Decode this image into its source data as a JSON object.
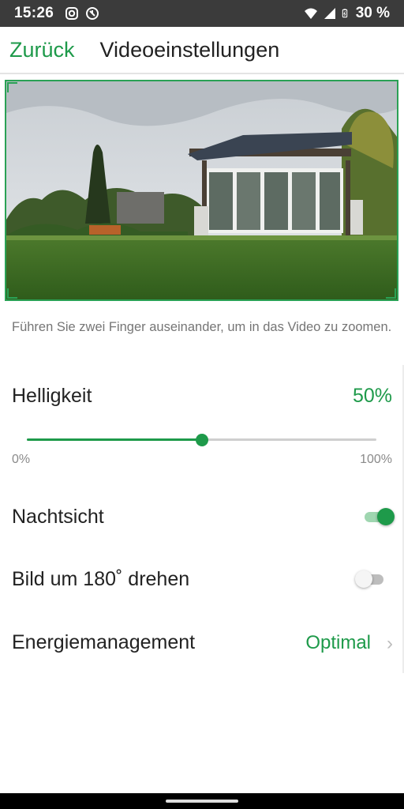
{
  "status_bar": {
    "time": "15:26",
    "left_icons": [
      "instagram-icon",
      "app-notification-icon"
    ],
    "right_icons": [
      "wifi-icon",
      "signal-icon",
      "battery-icon"
    ],
    "battery": "30 %"
  },
  "header": {
    "back_label": "Zurück",
    "title": "Videoeinstellungen"
  },
  "video_preview": {
    "description_icon": "camera-live-view"
  },
  "hint": "Führen Sie zwei Finger auseinander, um in das Video zu zoomen.",
  "brightness": {
    "label": "Helligkeit",
    "value_text": "50%",
    "value": 0.5,
    "min_label": "0%",
    "max_label": "100%"
  },
  "night_vision": {
    "label": "Nachtsicht",
    "enabled": true
  },
  "rotate": {
    "label": "Bild um 180˚ drehen",
    "enabled": false
  },
  "energy": {
    "label": "Energiemanagement",
    "value": "Optimal",
    "chevron_icon": "chevron-right-icon"
  },
  "colors": {
    "accent": "#1e9a4a",
    "text": "#222222",
    "hint": "#757575",
    "status_bar": "#3b3b3b"
  }
}
